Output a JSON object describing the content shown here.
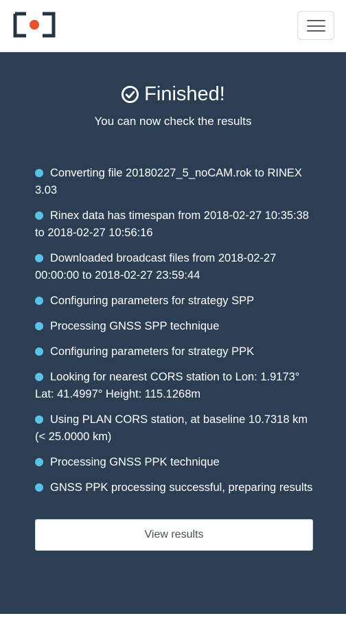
{
  "header": {
    "logo_icon": "camera-logo-icon",
    "menu_icon": "hamburger-menu-icon"
  },
  "status": {
    "icon": "check-circle-icon",
    "title": "Finished!",
    "subtitle": "You can now check the results"
  },
  "log": {
    "items": [
      {
        "text": "Converting file 20180227_5_noCAM.rok to RINEX 3.03"
      },
      {
        "text": "Rinex data has timespan from 2018-02-27 10:35:38 to 2018-02-27 10:56:16"
      },
      {
        "text": "Downloaded broadcast files from 2018-02-27 00:00:00 to 2018-02-27 23:59:44"
      },
      {
        "text": "Configuring parameters for strategy SPP"
      },
      {
        "text": "Processing GNSS SPP technique"
      },
      {
        "text": "Configuring parameters for strategy PPK"
      },
      {
        "text": "Looking for nearest CORS station to Lon: 1.9173° Lat: 41.4997° Height: 115.1268m"
      },
      {
        "text": "Using PLAN CORS station, at baseline 10.7318 km (< 25.0000 km)"
      },
      {
        "text": "Processing GNSS PPK technique"
      },
      {
        "text": "GNSS PPK processing successful, preparing results"
      }
    ]
  },
  "actions": {
    "view_results_label": "View results"
  },
  "colors": {
    "panel_bg": "#2b3e54",
    "bullet": "#5bc2e7",
    "logo_accent": "#e8502a",
    "logo_frame": "#243447"
  }
}
